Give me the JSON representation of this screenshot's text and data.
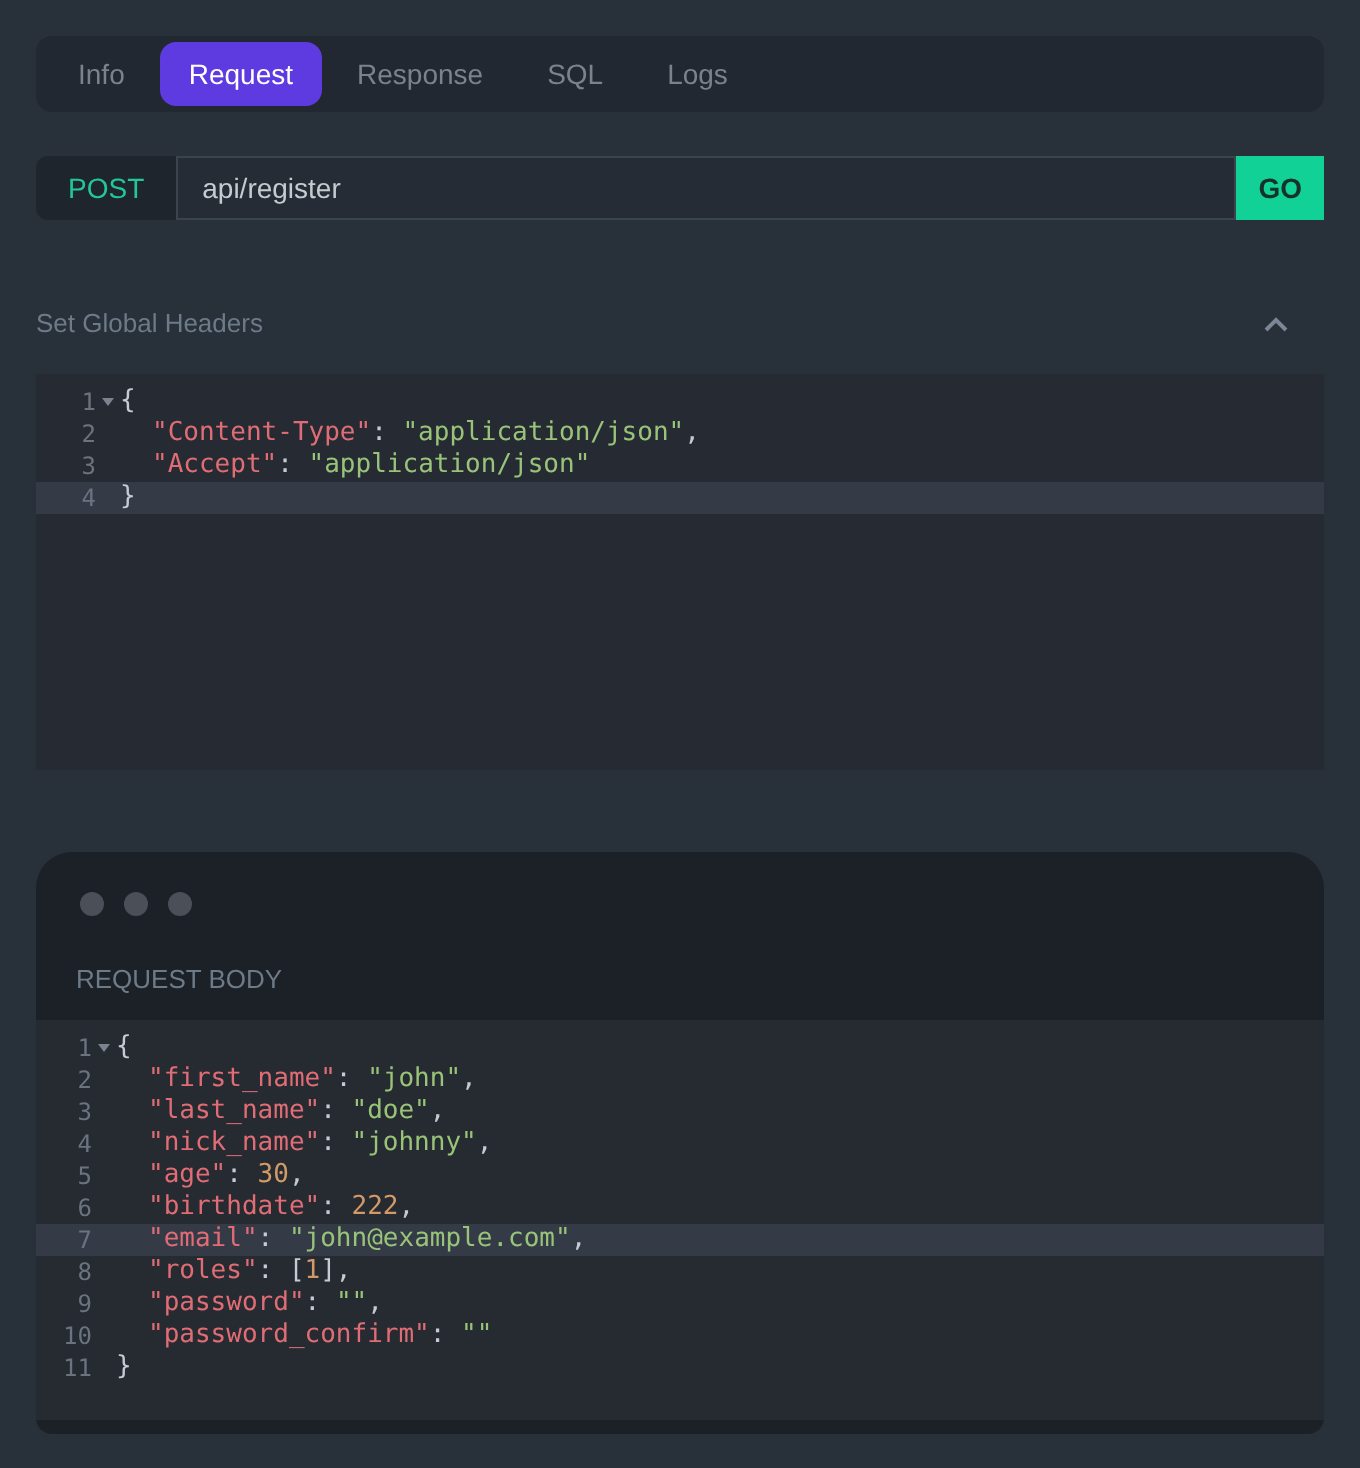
{
  "tabs": [
    {
      "label": "Info",
      "selected": false
    },
    {
      "label": "Request",
      "selected": true
    },
    {
      "label": "Response",
      "selected": false
    },
    {
      "label": "SQL",
      "selected": false
    },
    {
      "label": "Logs",
      "selected": false
    }
  ],
  "request": {
    "method": "POST",
    "url": "api/register",
    "button": "GO"
  },
  "headers": {
    "title": "Set Global Headers",
    "expanded": true,
    "lines": [
      {
        "number": "1",
        "foldable": true,
        "indented": false,
        "active": false,
        "tokens": [
          {
            "kind": "punct",
            "text": "{"
          }
        ]
      },
      {
        "number": "2",
        "foldable": false,
        "indented": true,
        "active": false,
        "tokens": [
          {
            "kind": "key",
            "text": "\"Content-Type\""
          },
          {
            "kind": "punct",
            "text": ": "
          },
          {
            "kind": "string",
            "text": "\"application/json\""
          },
          {
            "kind": "punct",
            "text": ","
          }
        ]
      },
      {
        "number": "3",
        "foldable": false,
        "indented": true,
        "active": false,
        "tokens": [
          {
            "kind": "key",
            "text": "\"Accept\""
          },
          {
            "kind": "punct",
            "text": ": "
          },
          {
            "kind": "string",
            "text": "\"application/json\""
          }
        ]
      },
      {
        "number": "4",
        "foldable": false,
        "indented": false,
        "active": true,
        "tokens": [
          {
            "kind": "punct",
            "text": "}"
          }
        ]
      }
    ]
  },
  "body": {
    "title": "REQUEST BODY",
    "lines": [
      {
        "number": "1",
        "foldable": true,
        "indented": false,
        "active": false,
        "tokens": [
          {
            "kind": "punct",
            "text": "{"
          }
        ]
      },
      {
        "number": "2",
        "foldable": false,
        "indented": true,
        "active": false,
        "tokens": [
          {
            "kind": "key",
            "text": "\"first_name\""
          },
          {
            "kind": "punct",
            "text": ": "
          },
          {
            "kind": "string",
            "text": "\"john\""
          },
          {
            "kind": "punct",
            "text": ","
          }
        ]
      },
      {
        "number": "3",
        "foldable": false,
        "indented": true,
        "active": false,
        "tokens": [
          {
            "kind": "key",
            "text": "\"last_name\""
          },
          {
            "kind": "punct",
            "text": ": "
          },
          {
            "kind": "string",
            "text": "\"doe\""
          },
          {
            "kind": "punct",
            "text": ","
          }
        ]
      },
      {
        "number": "4",
        "foldable": false,
        "indented": true,
        "active": false,
        "tokens": [
          {
            "kind": "key",
            "text": "\"nick_name\""
          },
          {
            "kind": "punct",
            "text": ": "
          },
          {
            "kind": "string",
            "text": "\"johnny\""
          },
          {
            "kind": "punct",
            "text": ","
          }
        ]
      },
      {
        "number": "5",
        "foldable": false,
        "indented": true,
        "active": false,
        "tokens": [
          {
            "kind": "key",
            "text": "\"age\""
          },
          {
            "kind": "punct",
            "text": ": "
          },
          {
            "kind": "number",
            "text": "30"
          },
          {
            "kind": "punct",
            "text": ","
          }
        ]
      },
      {
        "number": "6",
        "foldable": false,
        "indented": true,
        "active": false,
        "tokens": [
          {
            "kind": "key",
            "text": "\"birthdate\""
          },
          {
            "kind": "punct",
            "text": ": "
          },
          {
            "kind": "number",
            "text": "222"
          },
          {
            "kind": "punct",
            "text": ","
          }
        ]
      },
      {
        "number": "7",
        "foldable": false,
        "indented": true,
        "active": true,
        "tokens": [
          {
            "kind": "key",
            "text": "\"email\""
          },
          {
            "kind": "punct",
            "text": ": "
          },
          {
            "kind": "string",
            "text": "\"john@example.com\""
          },
          {
            "kind": "punct",
            "text": ","
          }
        ]
      },
      {
        "number": "8",
        "foldable": false,
        "indented": true,
        "active": false,
        "tokens": [
          {
            "kind": "key",
            "text": "\"roles\""
          },
          {
            "kind": "punct",
            "text": ": ["
          },
          {
            "kind": "number",
            "text": "1"
          },
          {
            "kind": "punct",
            "text": "],"
          }
        ]
      },
      {
        "number": "9",
        "foldable": false,
        "indented": true,
        "active": false,
        "tokens": [
          {
            "kind": "key",
            "text": "\"password\""
          },
          {
            "kind": "punct",
            "text": ": "
          },
          {
            "kind": "string",
            "text": "\"\""
          },
          {
            "kind": "punct",
            "text": ","
          }
        ]
      },
      {
        "number": "10",
        "foldable": false,
        "indented": true,
        "active": false,
        "tokens": [
          {
            "kind": "key",
            "text": "\"password_confirm\""
          },
          {
            "kind": "punct",
            "text": ": "
          },
          {
            "kind": "string",
            "text": "\"\""
          }
        ]
      },
      {
        "number": "11",
        "foldable": false,
        "indented": false,
        "active": false,
        "tokens": [
          {
            "kind": "punct",
            "text": "}"
          }
        ]
      }
    ]
  }
}
